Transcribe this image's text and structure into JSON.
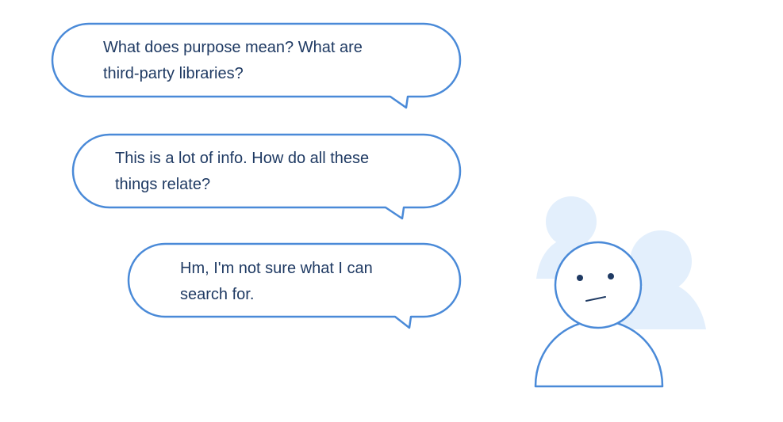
{
  "colors": {
    "outline": "#4a8ad8",
    "text": "#1f3a63",
    "background_figure": "#e3effc",
    "background": "#ffffff"
  },
  "bubbles": [
    {
      "lines": [
        "What does purpose mean? What are",
        "third-party libraries?"
      ]
    },
    {
      "lines": [
        "This is a lot of info. How do all these",
        "things relate?"
      ]
    },
    {
      "lines": [
        "Hm, I'm not sure what I can",
        "search for."
      ]
    }
  ],
  "figure": {
    "expression": "confused",
    "icon": "confused-person-icon",
    "background_icons": [
      "person-silhouette-icon",
      "person-silhouette-icon"
    ]
  }
}
